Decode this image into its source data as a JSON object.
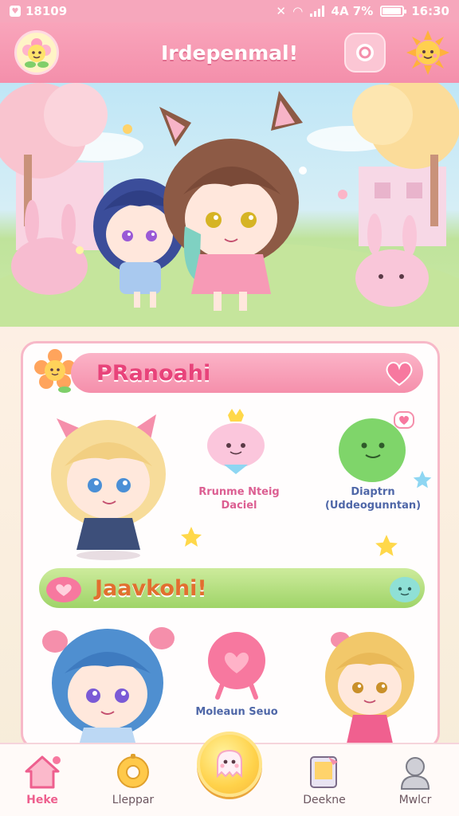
{
  "status_bar": {
    "left_text": "18109",
    "right_text": "4A 7%",
    "time": "16:30",
    "battery_level": 0.95
  },
  "header": {
    "title": "Irdepenmal!",
    "left_icon": "flower-mascot-icon",
    "search_icon": "search-icon",
    "right_icon": "sun-mascot-icon"
  },
  "hero": {
    "scene": "two-chibi-girls-in-pastel-park"
  },
  "main_card": {
    "section1": {
      "title": "PRanoahi",
      "badge_icon": "flower-mascot-icon",
      "heart_icon": "heart-icon",
      "items": [
        {
          "icon": "chibi-blonde-cat-ear-girl-icon",
          "label": ""
        },
        {
          "icon": "pink-crown-blob-pet-icon",
          "label": "Rrunme Nteig\nDaciel"
        },
        {
          "icon": "green-slime-pet-icon",
          "label": "Diaptrn\n(Uddeogunntan)"
        }
      ]
    },
    "section2": {
      "title": "Jaavkohi!",
      "badge_icon": "pink-slime-icon",
      "end_icon": "teal-slime-icon",
      "items": [
        {
          "icon": "chibi-blue-hair-girl-icon",
          "label": ""
        },
        {
          "icon": "pink-heart-balloon-icon",
          "label": "Moleaun Seuo"
        },
        {
          "icon": "chibi-blonde-girl-icon",
          "label": ""
        }
      ]
    }
  },
  "bottom_nav": {
    "items": [
      {
        "label": "Heke",
        "icon": "home-icon",
        "active": true
      },
      {
        "label": "Lleppar",
        "icon": "donut-icon",
        "active": false
      },
      {
        "label": "Deekne",
        "icon": "note-icon",
        "active": false
      },
      {
        "label": "Mwlcr",
        "icon": "profile-icon",
        "active": false
      }
    ],
    "fab_icon": "ghost-mascot-icon"
  },
  "colors": {
    "header_pink": "#f48fab",
    "accent_pink": "#e8437a",
    "banner_green": "#9fd468",
    "fab_yellow": "#ffd24a"
  }
}
